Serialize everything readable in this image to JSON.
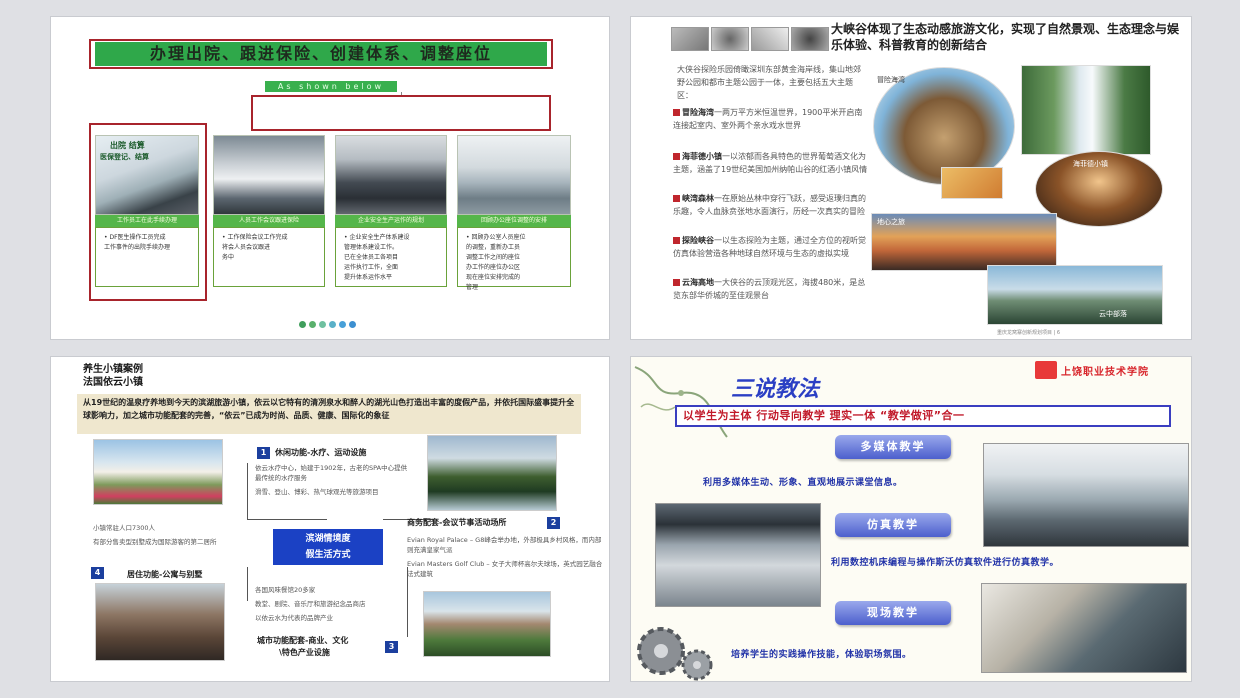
{
  "slide1": {
    "title": "办理出院、跟进保险、创建体系、调整座位",
    "subtitle": "As shown below",
    "cards": [
      {
        "photo_label": "出院 结算",
        "photo_sublabel": "医保登记、结算",
        "bar": "工作员工在此手续办理",
        "lines": [
          "• DF医生操作工员完成",
          "工作事件的出院手续办理"
        ]
      },
      {
        "photo_label": "",
        "photo_sublabel": "",
        "bar": "人员工作会议跟进保险",
        "lines": [
          "• 工作保险会议工作完成",
          "将会人员会议跟进",
          "务中"
        ]
      },
      {
        "photo_label": "",
        "photo_sublabel": "",
        "bar": "企业安全生产运作的规划",
        "lines": [
          "• 企业安全生产体系建设",
          "管理体系建设工作。",
          "已在全体员工各项目",
          "运作执行工作，全面",
          "提升体系运作水平"
        ]
      },
      {
        "photo_label": "",
        "photo_sublabel": "",
        "bar": "回顾办公座位调整的安排",
        "lines": [
          "• 回顾办公室人员座位",
          "的调整，重新办工员",
          "调整工作之间的座位",
          "办工作的座位办公区",
          "现在座位安排完成的",
          "管理"
        ]
      }
    ],
    "dot_colors": [
      "#3f9e5c",
      "#59b06c",
      "#6fc0a0",
      "#5ab0c8",
      "#48a0d8",
      "#3c8fd0"
    ]
  },
  "slide2": {
    "title": "大峡谷体现了生态动感旅游文化，实现了自然景观、生态理念与娱乐体验、科普教育的创新结合",
    "intro": "大侠谷探险乐园倚瞰深圳东部黄金海岸线，集山地郊野公园和都市主题公园于一体，主要包括五大主题区：",
    "items": [
      {
        "name": "冒险海湾",
        "text": "一两万平方米恒温世界，1900平米开启南连接起室内、室外两个亲水戏水世界"
      },
      {
        "name": "海菲德小镇",
        "text": "一以浓郁而各具特色的世界葡萄酒文化为主题，涵盖了19世纪美国加州纳帕山谷的红酒小镇风情"
      },
      {
        "name": "峡湾森林",
        "text": "一在原始丛林中穿行飞跃，感受返璞归真的乐趣，令人血脉贲张地水面演行，历经一次真实的冒险"
      },
      {
        "name": "探险峡谷",
        "text": "一以生态探险为主题，通过全方位的视听觉仿真体验营造各种地球自然环境与生态的虚拟实境"
      },
      {
        "name": "云海高地",
        "text": "一大侠谷的云顶观光区，海拔480米，是总览东部华侨城的至佳观景台"
      }
    ],
    "photo_labels": [
      "冒险海湾",
      "海菲德小镇",
      "地心之旅",
      "云中部落"
    ],
    "footer": "重庆龙窝寨创新规划项目 | 6"
  },
  "slide3": {
    "title_line1": "养生小镇案例",
    "title_line2": "法国依云小镇",
    "band": "从19世纪的温泉疗养地到今天的滨湖旅游小镇，依云以它特有的清冽泉水和醉人的湖光山色打造出丰富的度假产品，并依托国际盛事提升全球影响力，加之城市功能配套的完善，“依云”已成为时尚、品质、健康、国际化的象征",
    "center_line1": "滨湖情境度",
    "center_line2": "假生活方式",
    "s1_num": "1",
    "s1_head": "休闲功能-水疗、运动设施",
    "s1_lines": [
      "依云水疗中心，始建于1902年，古老的SPA中心提供最传统的水疗服务",
      "滑雪、登山、博彩、热气球观光等旅游项目"
    ],
    "s2_num": "2",
    "s2_head": "商务配套-会议节事活动场所",
    "s2_lines": [
      "Evian Royal Palace – G8峰会举办地，外部极具乡村风格，而内部则充满皇家气派",
      "Evian Masters Golf Club – 女子大师杯高尔夫球场，英式园艺融合法式建筑"
    ],
    "s3_num": "3",
    "s3_head_line1": "城市功能配套-商业、文化",
    "s3_head_line2": "\\特色产业设施",
    "s3_lines": [
      "各国风味餐馆20多家",
      "教堂、剧院、音乐厅和旅游纪念品商店",
      "以依云水为代表的品牌产业"
    ],
    "s4_num": "4",
    "s4_head": "居住功能-公寓与别墅",
    "s4_lines": [
      "小镇常驻人口7300人",
      "有部分售卖型别墅成为国际游客的第二居所"
    ]
  },
  "slide4": {
    "title": "三说教法",
    "logo_text": "上饶职业技术学院",
    "tagline": "以学生为主体 行动导向教学 理实一体 “教学做评”合一",
    "methods": [
      {
        "label": "多媒体教学",
        "desc": "利用多媒体生动、形象、直观地展示课堂信息。"
      },
      {
        "label": "仿真教学",
        "desc": "利用数控机床编程与操作斯沃仿真软件进行仿真教学。"
      },
      {
        "label": "现场教学",
        "desc": "培养学生的实践操作技能，体验职场氛围。"
      }
    ]
  }
}
